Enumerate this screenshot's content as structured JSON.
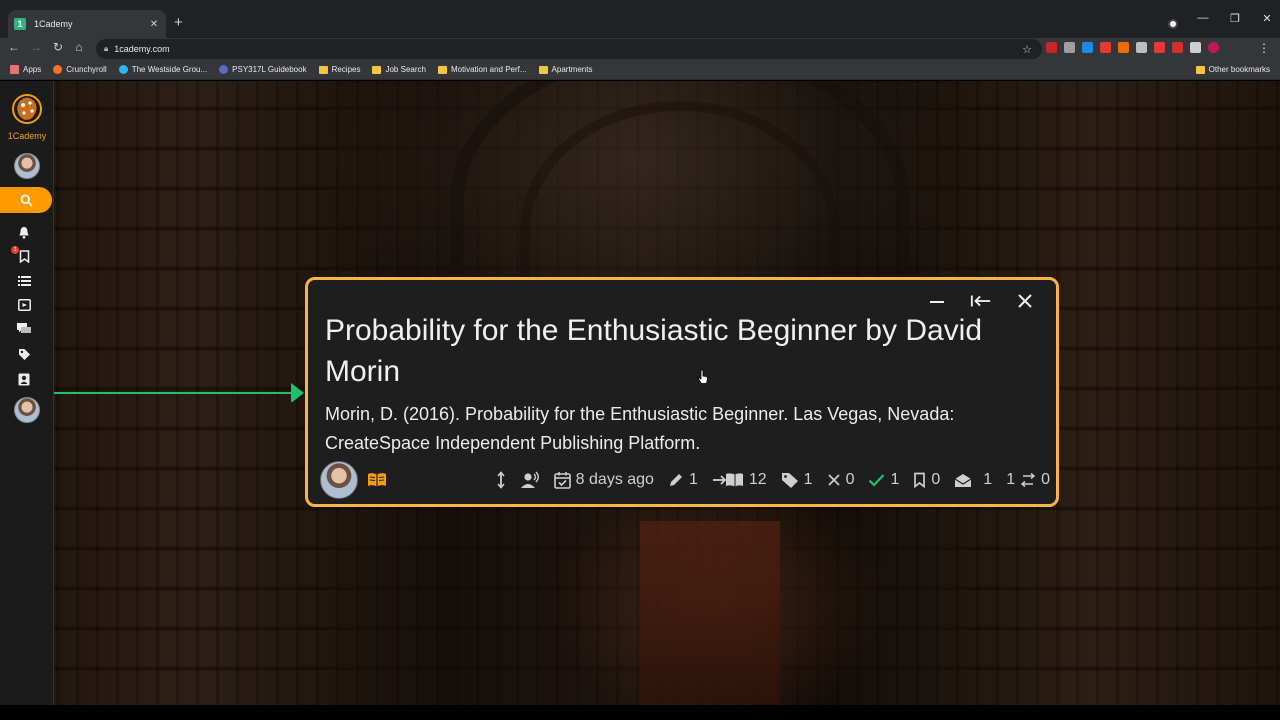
{
  "browser": {
    "tab_title": "1Cademy",
    "tab_favicon": "1",
    "url": "1cademy.com",
    "bookmarks": [
      {
        "label": "Apps",
        "icon": "apps-grid-icon"
      },
      {
        "label": "Crunchyroll",
        "icon": "crunchyroll-icon"
      },
      {
        "label": "The Westside Grou...",
        "icon": "westside-icon"
      },
      {
        "label": "PSY317L Guidebook",
        "icon": "guidebook-icon"
      },
      {
        "label": "Recipes",
        "icon": "folder-icon"
      },
      {
        "label": "Job Search",
        "icon": "folder-icon"
      },
      {
        "label": "Motivation and Perf...",
        "icon": "folder-icon"
      },
      {
        "label": "Apartments",
        "icon": "folder-icon"
      }
    ],
    "other_bookmarks": "Other bookmarks",
    "extensions": [
      "#c62828",
      "#9e9e9e",
      "#1e88e5",
      "#e53935",
      "#ef6c00",
      "#bdbdbd",
      "#e53935",
      "#d32f2f",
      "#cfcfcf",
      "#c2185b"
    ]
  },
  "sidebar": {
    "logo_text": "1Cademy",
    "notification_badge": "1",
    "accent_color": "#ff9a00"
  },
  "node": {
    "title": "Probability for the Enthusiastic Beginner by David Morin",
    "body": "Morin, D. (2016). Probability for the Enthusiastic Beginner. Las Vegas, Nevada: CreateSpace Independent Publishing Platform.",
    "border_color": "#f7b54a",
    "stats": {
      "last_updated": "8 days ago",
      "edits": "1",
      "references": "12",
      "tags": "1",
      "wrong_votes": "0",
      "correct_votes": "1",
      "bookmarks": "0",
      "unread": "1",
      "parents": "1",
      "children": "0"
    }
  }
}
